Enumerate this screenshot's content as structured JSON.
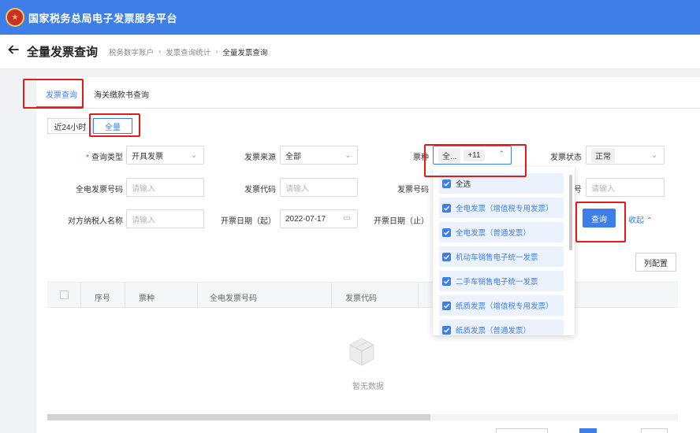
{
  "app": {
    "title": "国家税务总局电子发票服务平台",
    "emblem_icon": "national-emblem-icon"
  },
  "header": {
    "back_icon": "arrow-left-icon",
    "page_title": "全量发票查询",
    "breadcrumb": [
      "税务数字账户",
      "发票查询统计",
      "全量发票查询"
    ]
  },
  "tabs": [
    {
      "label": "发票查询",
      "active": true
    },
    {
      "label": "海关缴款书查询",
      "active": false
    }
  ],
  "time_range": [
    {
      "label": "近24小时",
      "active": false
    },
    {
      "label": "全量",
      "active": true
    }
  ],
  "form": {
    "query_type": {
      "label": "查询类型",
      "value": "开具发票"
    },
    "source": {
      "label": "发票来源",
      "value": "全部"
    },
    "ticket_type": {
      "label": "票种",
      "value": "全...",
      "more": "+11"
    },
    "status": {
      "label": "发票状态",
      "value": "正常"
    },
    "einvoice_no": {
      "label": "全电发票号码",
      "placeholder": "请输入"
    },
    "invoice_code": {
      "label": "发票代码",
      "placeholder": "请输入"
    },
    "invoice_no": {
      "label": "发票号码",
      "placeholder": "请输入"
    },
    "hidden_label_suffix": "号",
    "hidden_input": {
      "placeholder": "请输入"
    },
    "counterparty": {
      "label": "对方纳税人名称",
      "placeholder": "请输入"
    },
    "date_start": {
      "label": "开票日期（起）",
      "value": "2022-07-17"
    },
    "date_end": {
      "label": "开票日期（止）"
    },
    "query_button": "查询",
    "collapse_link": "收起"
  },
  "toolbar": {
    "column_config": "列配置"
  },
  "table": {
    "columns": [
      "序号",
      "票种",
      "全电发票号码",
      "发票代码"
    ],
    "empty_text": "暂无数据"
  },
  "ticket_dropdown": {
    "options": [
      {
        "label": "全选",
        "checked": true
      },
      {
        "label": "全电发票（增值税专用发票）",
        "checked": true
      },
      {
        "label": "全电发票（普通发票）",
        "checked": true
      },
      {
        "label": "机动车销售电子统一发票",
        "checked": true
      },
      {
        "label": "二手车销售电子统一发票",
        "checked": true
      },
      {
        "label": "纸质发票（增值税专用发票）",
        "checked": true
      },
      {
        "label": "纸质发票（普通发票）",
        "checked": true
      }
    ]
  },
  "colors": {
    "brand": "#3d7ee8",
    "annotation": "#e21b1b"
  }
}
